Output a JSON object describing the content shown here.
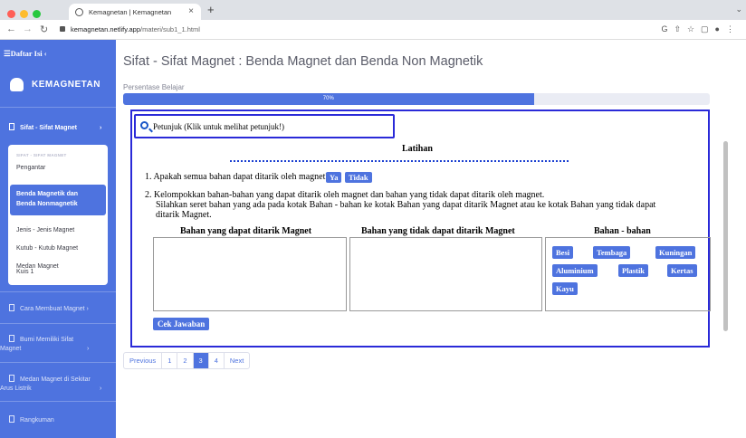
{
  "browser": {
    "tab_title": "Kemagnetan | Kemagnetan",
    "url_host": "kemagnetan.netlify.app",
    "url_path": "/materi/sub1_1.html"
  },
  "sidebar": {
    "toggle_label": "☰Daftar Isi ‹",
    "brand": "KEMAGNETAN",
    "active_section": "Sifat - Sifat Magnet",
    "submenu_header": "SIFAT - SIFAT MAGNET",
    "submenu_items": [
      "Pengantar",
      "Benda Magnetik dan",
      "Benda Nonmagnetik",
      "Jenis - Jenis Magnet",
      "Kutub - Kutub Magnet",
      "Medan Magnet",
      "Kuis 1"
    ],
    "sections": [
      {
        "label": "Cara Membuat Magnet"
      },
      {
        "label_line1": "Bumi Memiliki Sifat",
        "label_line2": "Magnet"
      },
      {
        "label_line1": "Medan Magnet di Sekitar",
        "label_line2": "Arus Listrik"
      },
      {
        "label": "Rangkuman"
      }
    ]
  },
  "main": {
    "title": "Sifat - Sifat Magnet : Benda Magnet dan Benda Non Magnetik",
    "progress_label": "Persentase Belajar",
    "progress_text": "70%",
    "progress_value": 0.7,
    "hint": "Petunjuk (Klik untuk melihat petunjuk!)",
    "exercise_title": "Latihan",
    "q1": "1. Apakah semua bahan dapat ditarik oleh magnet?",
    "q1_yes": "Ya",
    "q1_no": "Tidak",
    "q2_line1": "2. Kelompokkan bahan-bahan yang dapat ditarik oleh magnet dan bahan yang tidak dapat ditarik oleh magnet.",
    "q2_line2": "Silahkan seret bahan yang ada pada kotak Bahan - bahan ke kotak Bahan yang dapat ditarik Magnet atau ke kotak Bahan yang tidak dapat",
    "q2_line3": "ditarik Magnet.",
    "col_magnetic": "Bahan yang dapat ditarik Magnet",
    "col_nonmagnetic": "Bahan yang tidak dapat ditarik Magnet",
    "col_materials": "Bahan - bahan",
    "materials": [
      "Besi",
      "Tembaga",
      "Kuningan",
      "Aluminium",
      "Plastik",
      "Kertas",
      "Kayu"
    ],
    "check_button": "Cek Jawaban"
  },
  "pagination": {
    "prev": "Previous",
    "pages": [
      "1",
      "2",
      "3",
      "4"
    ],
    "current": "3",
    "next": "Next"
  },
  "colors": {
    "primary": "#4e73df",
    "panel_border": "#2a2ad8"
  }
}
